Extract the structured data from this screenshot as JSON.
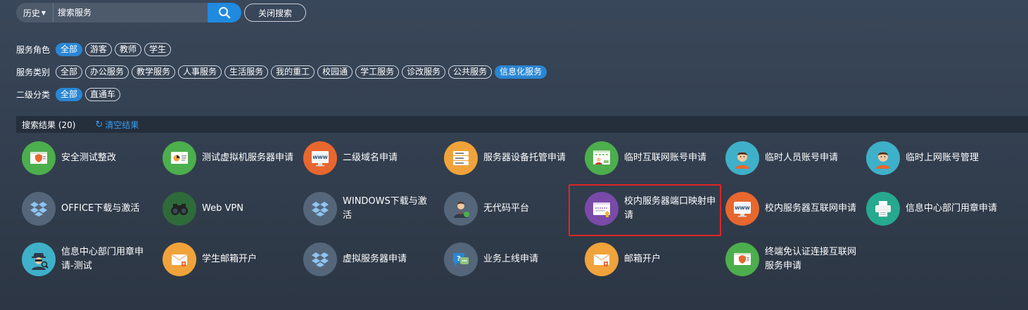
{
  "search": {
    "history_label": "历史",
    "placeholder": "搜索服务",
    "close_label": "关闭搜索"
  },
  "filters": [
    {
      "label": "服务角色",
      "chips": [
        {
          "text": "全部",
          "active": true
        },
        {
          "text": "游客",
          "active": false
        },
        {
          "text": "教师",
          "active": false
        },
        {
          "text": "学生",
          "active": false
        }
      ]
    },
    {
      "label": "服务类别",
      "chips": [
        {
          "text": "全部",
          "active": false
        },
        {
          "text": "办公服务",
          "active": false
        },
        {
          "text": "教学服务",
          "active": false
        },
        {
          "text": "人事服务",
          "active": false
        },
        {
          "text": "生活服务",
          "active": false
        },
        {
          "text": "我的重工",
          "active": false
        },
        {
          "text": "校园通",
          "active": false
        },
        {
          "text": "学工服务",
          "active": false
        },
        {
          "text": "诊改服务",
          "active": false
        },
        {
          "text": "公共服务",
          "active": false
        },
        {
          "text": "信息化服务",
          "active": true
        }
      ]
    },
    {
      "label": "二级分类",
      "chips": [
        {
          "text": "全部",
          "active": true
        },
        {
          "text": "直通车",
          "active": false
        }
      ]
    }
  ],
  "results": {
    "title": "搜索结果 (20)",
    "clear_label": "清空结果"
  },
  "services": [
    {
      "name": "安全测试整改",
      "icon": "shield-screen-icon",
      "color": "#4cae4c"
    },
    {
      "name": "测试虚拟机服务器申请",
      "icon": "chart-screen-icon",
      "color": "#4cae4c"
    },
    {
      "name": "二级域名申请",
      "icon": "www-monitor-icon",
      "color": "#e8672e"
    },
    {
      "name": "服务器设备托管申请",
      "icon": "server-rack-icon",
      "color": "#f0a33a"
    },
    {
      "name": "临时互联网账号申请",
      "icon": "user-browser-icon",
      "color": "#4cae4c"
    },
    {
      "name": "临时人员账号申请",
      "icon": "person-avatar-icon",
      "color": "#3fb0c9"
    },
    {
      "name": "临时上网账号管理",
      "icon": "person-avatar-icon",
      "color": "#3fb0c9"
    },
    {
      "name": "OFFICE下载与激活",
      "icon": "dropbox-icon",
      "color": "#55667a"
    },
    {
      "name": "Web VPN",
      "icon": "binoculars-icon",
      "color": "#2f6a3a"
    },
    {
      "name": "WINDOWS下载与激活",
      "icon": "dropbox-icon",
      "color": "#55667a"
    },
    {
      "name": "无代码平台",
      "icon": "businessman-icon",
      "color": "#55667a"
    },
    {
      "name": "校内服务器端口映射申请",
      "icon": "password-window-icon",
      "color": "#7a4aa8"
    },
    {
      "name": "校内服务器互联网申请",
      "icon": "www-monitor-icon",
      "color": "#e8672e"
    },
    {
      "name": "信息中心部门用章申请",
      "icon": "printer-icon",
      "color": "#26a98f"
    },
    {
      "name": "信息中心部门用章申请-测试",
      "icon": "detective-icon",
      "color": "#3fb0c9"
    },
    {
      "name": "学生邮箱开户",
      "icon": "envelope-icon",
      "color": "#f0a33a"
    },
    {
      "name": "虚拟服务器申请",
      "icon": "dropbox-icon",
      "color": "#55667a"
    },
    {
      "name": "业务上线申请",
      "icon": "help-chat-icon",
      "color": "#55667a"
    },
    {
      "name": "邮箱开户",
      "icon": "envelope-icon",
      "color": "#f0a33a"
    },
    {
      "name": "终端免认证连接互联网服务申请",
      "icon": "shield-screen-icon",
      "color": "#4cae4c"
    }
  ]
}
